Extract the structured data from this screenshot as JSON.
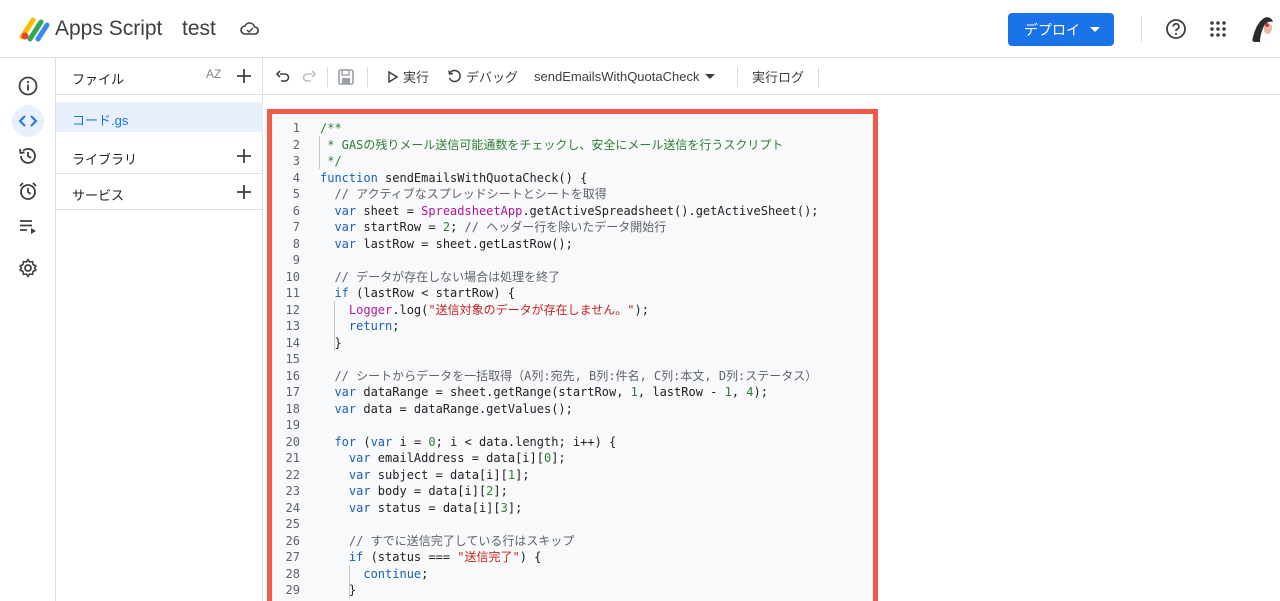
{
  "header": {
    "app_title": "Apps Script",
    "project_title": "test",
    "deploy_label": "デプロイ"
  },
  "files_panel": {
    "title": "ファイル",
    "sort_label": "AZ",
    "files": [
      {
        "name": "コード.gs"
      }
    ],
    "libraries_label": "ライブラリ",
    "services_label": "サービス"
  },
  "toolbar": {
    "run_label": "実行",
    "debug_label": "デバッグ",
    "function_name": "sendEmailsWithQuotaCheck",
    "log_label": "実行ログ"
  },
  "icons": {
    "rail": [
      "info-icon",
      "code-icon",
      "history-icon",
      "alarm-icon",
      "executions-icon",
      "settings-icon"
    ]
  },
  "colors": {
    "accent": "#1a73e8",
    "highlight_border": "#f15a4a"
  },
  "code": {
    "lines": [
      {
        "n": "1",
        "segs": [
          [
            "c",
            "/**"
          ]
        ]
      },
      {
        "n": "2",
        "segs": [
          [
            "c",
            " * GASの残りメール送信可能通数をチェックし、安全にメール送信を行うスクリプト"
          ]
        ]
      },
      {
        "n": "3",
        "segs": [
          [
            "c",
            " */"
          ]
        ]
      },
      {
        "n": "4",
        "segs": [
          [
            "k",
            "function"
          ],
          [
            "",
            " sendEmailsWithQuotaCheck() {"
          ]
        ]
      },
      {
        "n": "5",
        "segs": [
          [
            "cm",
            "  // アクティブなスプレッドシートとシートを取得"
          ]
        ]
      },
      {
        "n": "6",
        "segs": [
          [
            "k",
            "  var"
          ],
          [
            "",
            " sheet = "
          ],
          [
            "cls",
            "SpreadsheetApp"
          ],
          [
            "",
            ".getActiveSpreadsheet().getActiveSheet();"
          ]
        ]
      },
      {
        "n": "7",
        "segs": [
          [
            "k",
            "  var"
          ],
          [
            "",
            " startRow = "
          ],
          [
            "n",
            "2"
          ],
          [
            "",
            "; "
          ],
          [
            "cm",
            "// ヘッダー行を除いたデータ開始行"
          ]
        ]
      },
      {
        "n": "8",
        "segs": [
          [
            "k",
            "  var"
          ],
          [
            "",
            " lastRow = sheet.getLastRow();"
          ]
        ]
      },
      {
        "n": "9",
        "segs": [
          [
            "",
            ""
          ]
        ]
      },
      {
        "n": "10",
        "segs": [
          [
            "cm",
            "  // データが存在しない場合は処理を終了"
          ]
        ]
      },
      {
        "n": "11",
        "segs": [
          [
            "k",
            "  if"
          ],
          [
            "",
            " (lastRow < startRow) {"
          ]
        ]
      },
      {
        "n": "12",
        "segs": [
          [
            "cls",
            "    Logger"
          ],
          [
            "",
            ".log("
          ],
          [
            "s",
            "\"送信対象のデータが存在しません。\""
          ],
          [
            "",
            ");"
          ]
        ]
      },
      {
        "n": "13",
        "segs": [
          [
            "k",
            "    return"
          ],
          [
            "",
            ";"
          ]
        ]
      },
      {
        "n": "14",
        "segs": [
          [
            "",
            "  }"
          ]
        ]
      },
      {
        "n": "15",
        "segs": [
          [
            "",
            ""
          ]
        ]
      },
      {
        "n": "16",
        "segs": [
          [
            "cm",
            "  // シートからデータを一括取得（A列:宛先, B列:件名, C列:本文, D列:ステータス）"
          ]
        ]
      },
      {
        "n": "17",
        "segs": [
          [
            "k",
            "  var"
          ],
          [
            "",
            " dataRange = sheet.getRange(startRow, "
          ],
          [
            "n",
            "1"
          ],
          [
            "",
            ", lastRow - "
          ],
          [
            "n",
            "1"
          ],
          [
            "",
            ", "
          ],
          [
            "n",
            "4"
          ],
          [
            "",
            ");"
          ]
        ]
      },
      {
        "n": "18",
        "segs": [
          [
            "k",
            "  var"
          ],
          [
            "",
            " data = dataRange.getValues();"
          ]
        ]
      },
      {
        "n": "19",
        "segs": [
          [
            "",
            ""
          ]
        ]
      },
      {
        "n": "20",
        "segs": [
          [
            "k",
            "  for"
          ],
          [
            "",
            " ("
          ],
          [
            "k",
            "var"
          ],
          [
            "",
            " i = "
          ],
          [
            "n",
            "0"
          ],
          [
            "",
            "; i < data.length; i++) {"
          ]
        ]
      },
      {
        "n": "21",
        "segs": [
          [
            "k",
            "    var"
          ],
          [
            "",
            " emailAddress = data[i]["
          ],
          [
            "n",
            "0"
          ],
          [
            "",
            "];"
          ]
        ]
      },
      {
        "n": "22",
        "segs": [
          [
            "k",
            "    var"
          ],
          [
            "",
            " subject = data[i]["
          ],
          [
            "n",
            "1"
          ],
          [
            "",
            "];"
          ]
        ]
      },
      {
        "n": "23",
        "segs": [
          [
            "k",
            "    var"
          ],
          [
            "",
            " body = data[i]["
          ],
          [
            "n",
            "2"
          ],
          [
            "",
            "];"
          ]
        ]
      },
      {
        "n": "24",
        "segs": [
          [
            "k",
            "    var"
          ],
          [
            "",
            " status = data[i]["
          ],
          [
            "n",
            "3"
          ],
          [
            "",
            "];"
          ]
        ]
      },
      {
        "n": "25",
        "segs": [
          [
            "",
            ""
          ]
        ]
      },
      {
        "n": "26",
        "segs": [
          [
            "cm",
            "    // すでに送信完了している行はスキップ"
          ]
        ]
      },
      {
        "n": "27",
        "segs": [
          [
            "k",
            "    if"
          ],
          [
            "",
            " (status === "
          ],
          [
            "s",
            "\"送信完了\""
          ],
          [
            "",
            ") {"
          ]
        ]
      },
      {
        "n": "28",
        "segs": [
          [
            "k",
            "      continue"
          ],
          [
            "",
            ";"
          ]
        ]
      },
      {
        "n": "29",
        "segs": [
          [
            "",
            "    }"
          ]
        ]
      }
    ]
  }
}
